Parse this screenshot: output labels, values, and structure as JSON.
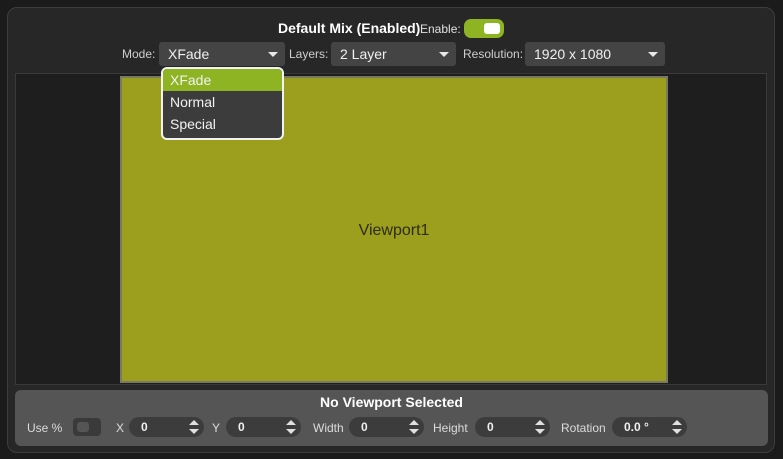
{
  "header": {
    "title": "Default Mix (Enabled)",
    "enable_label": "Enable:",
    "enabled": true
  },
  "controls": {
    "mode_label": "Mode:",
    "mode_value": "XFade",
    "layers_label": "Layers:",
    "layers_value": "2 Layer",
    "resolution_label": "Resolution:",
    "resolution_value": "1920 x 1080"
  },
  "mode_dropdown": {
    "options": [
      "XFade",
      "Normal",
      "Special"
    ],
    "selected": "XFade"
  },
  "canvas": {
    "viewport_label": "Viewport1"
  },
  "viewport_panel": {
    "title": "No Viewport Selected",
    "use_percent_label": "Use %",
    "use_percent": false,
    "x_label": "X",
    "x_value": "0",
    "y_label": "Y",
    "y_value": "0",
    "width_label": "Width",
    "width_value": "0",
    "height_label": "Height",
    "height_value": "0",
    "rotation_label": "Rotation",
    "rotation_value": "0.0 °"
  },
  "colors": {
    "accent": "#8fb423",
    "viewport_fill": "#9c9e1d",
    "panel_bg": "#272727",
    "bottom_bg": "#555555"
  }
}
